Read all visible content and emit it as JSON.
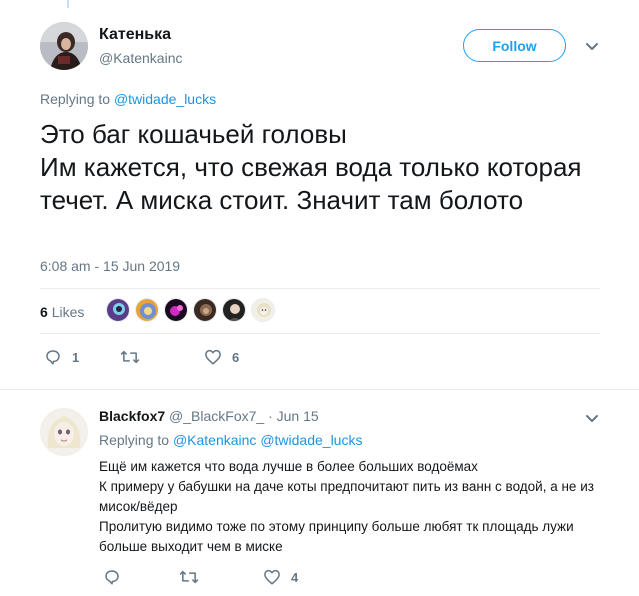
{
  "main_tweet": {
    "author_name": "Катенька",
    "author_handle": "@Katenkainc",
    "follow_label": "Follow",
    "replying_prefix": "Replying to",
    "replying_to": "@twidade_lucks",
    "text_lines": [
      "Это баг кошачьей головы",
      "Им кажется, что свежая вода только которая течет. А миска стоит. Значит там болото"
    ],
    "timestamp": "6:08 am - 15 Jun 2019",
    "likes_count": "6",
    "likes_label": "Likes",
    "reply_count": "1",
    "retweet_count": "",
    "like_count": "6"
  },
  "reply": {
    "author_name": "Blackfox7",
    "author_handle": "@_BlackFox7_",
    "date": "· Jun 15",
    "replying_prefix": "Replying to",
    "replying_to_1": "@Katenkainc",
    "replying_to_2": "@twidade_lucks",
    "text_lines": [
      "Ещё им кажется что вода лучше в более больших водоёмах",
      "К примеру у бабушки на даче коты предпочитают пить из ванн с водой, а не из мисок/вёдер",
      "Пролитую видимо тоже по этому принципу больше любят тк площадь лужи больше выходит чем в миске"
    ],
    "reply_count": "",
    "retweet_count": "",
    "like_count": "4"
  },
  "colors": {
    "accent": "#1da1f2",
    "link": "#1b95e0",
    "muted": "#657786",
    "text": "#14171a",
    "separator": "#e6ecf0"
  },
  "icons": [
    "chevron-down-icon",
    "reply-icon",
    "retweet-icon",
    "heart-icon"
  ]
}
